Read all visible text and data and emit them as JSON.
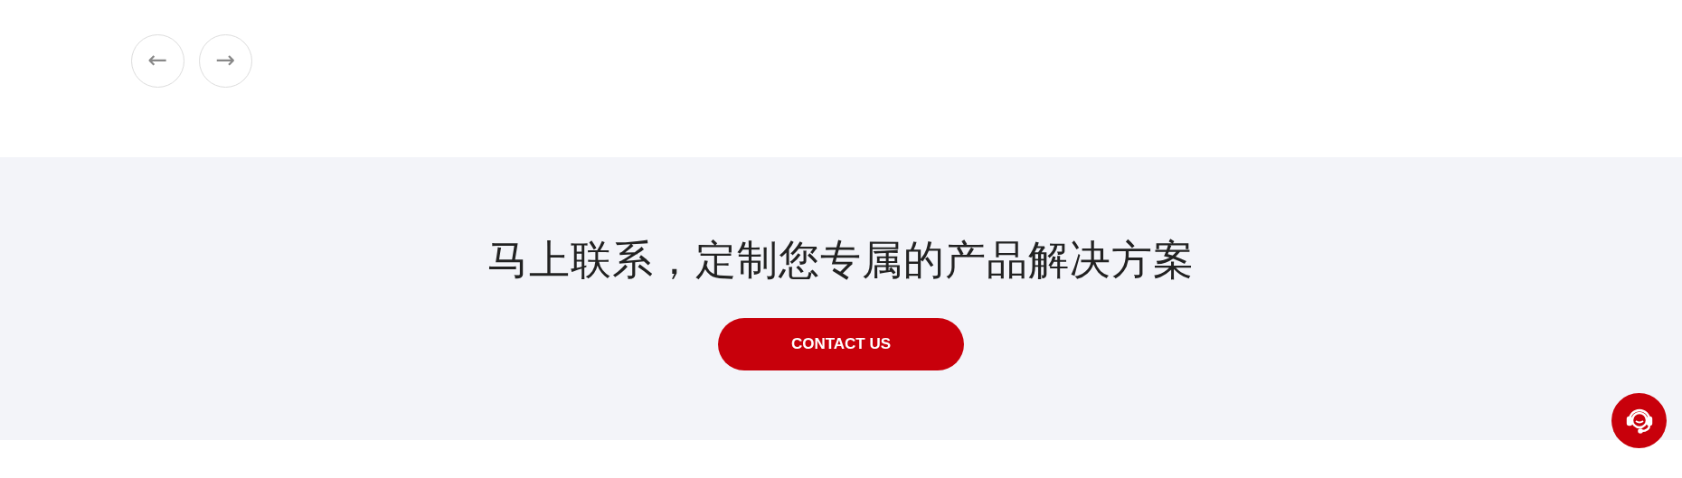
{
  "carousel_nav": {
    "prev_label": "←",
    "next_label": "→"
  },
  "cta": {
    "heading": "马上联系，定制您专属的产品解决方案",
    "button": "CONTACT US"
  }
}
